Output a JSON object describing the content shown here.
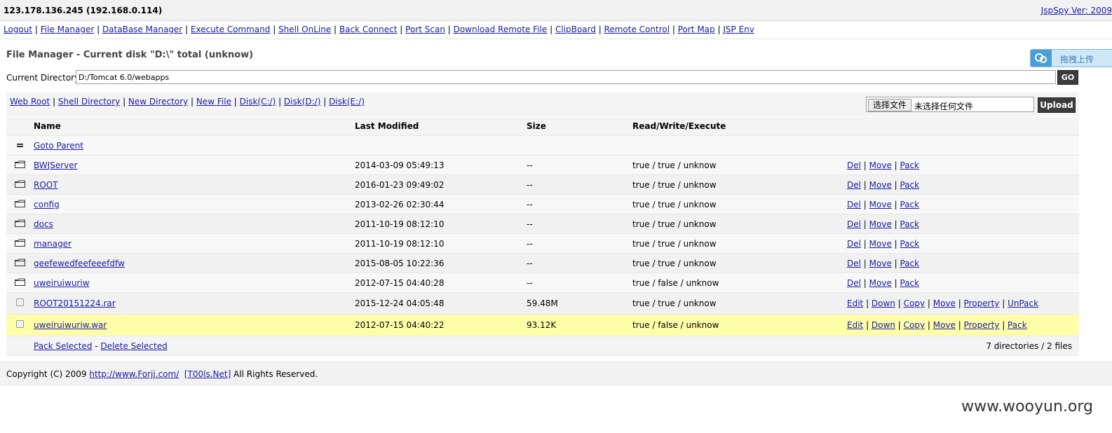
{
  "header": {
    "host": "123.178.136.245 (192.168.0.114)",
    "version": "JspSpy Ver: 2009"
  },
  "nav": [
    "Logout",
    "File Manager",
    "DataBase Manager",
    "Execute Command",
    "Shell OnLine",
    "Back Connect",
    "Port Scan",
    "Download Remote File",
    "ClipBoard",
    "Remote Control",
    "Port Map",
    "JSP Env"
  ],
  "title": "File Manager - Current disk \"D:\\\" total (unknow)",
  "upload_drag": "拖拽上传",
  "current_dir": {
    "label": "Current Directory",
    "value": "D:/Tomcat 6.0/webapps",
    "go": "GO"
  },
  "quick_links": [
    "Web Root",
    "Shell Directory",
    "New Directory",
    "New File",
    "Disk(C:/)",
    "Disk(D:/)",
    "Disk(E:/)"
  ],
  "file_upload": {
    "choose": "选择文件",
    "none": "未选择任何文件",
    "upload": "Upload"
  },
  "columns": {
    "name": "Name",
    "modified": "Last Modified",
    "size": "Size",
    "rwx": "Read/Write/Execute"
  },
  "parent": {
    "icon": "=",
    "label": "Goto Parent"
  },
  "dirs": [
    {
      "name": "BWJServer",
      "modified": "2014-03-09 05:49:13",
      "size": "--",
      "rwx": "true / true / unknow"
    },
    {
      "name": "ROOT",
      "modified": "2016-01-23 09:49:02",
      "size": "--",
      "rwx": "true / true / unknow"
    },
    {
      "name": "config",
      "modified": "2013-02-26 02:30:44",
      "size": "--",
      "rwx": "true / true / unknow"
    },
    {
      "name": "docs",
      "modified": "2011-10-19 08:12:10",
      "size": "--",
      "rwx": "true / true / unknow"
    },
    {
      "name": "manager",
      "modified": "2011-10-19 08:12:10",
      "size": "--",
      "rwx": "true / true / unknow"
    },
    {
      "name": "geefewedfeefeeefdfw",
      "modified": "2015-08-05 10:22:36",
      "size": "--",
      "rwx": "true / true / unknow"
    },
    {
      "name": "uweiruiwuriw",
      "modified": "2012-07-15 04:40:28",
      "size": "--",
      "rwx": "true / false / unknow"
    }
  ],
  "dir_actions": [
    "Del",
    "Move",
    "Pack"
  ],
  "files": [
    {
      "name": "ROOT20151224.rar",
      "modified": "2015-12-24 04:05:48",
      "size": "59.48M",
      "rwx": "true / true / unknow",
      "actions": [
        "Edit",
        "Down",
        "Copy",
        "Move",
        "Property",
        "UnPack"
      ]
    },
    {
      "name": "uweiruiwuriw.war",
      "modified": "2012-07-15 04:40:22",
      "size": "93.12K",
      "rwx": "true / false / unknow",
      "actions": [
        "Edit",
        "Down",
        "Copy",
        "Move",
        "Property",
        "Pack"
      ]
    }
  ],
  "highlight_color": "#ffffaa",
  "footer_actions": {
    "pack": "Pack Selected",
    "sep": "-",
    "delete": "Delete Selected",
    "summary": "7 directories / 2 files"
  },
  "copyright": {
    "prefix": "Copyright (C) 2009",
    "link": "http://www.Forjj.com/",
    "team": "[T00ls.Net]",
    "suffix": "All Rights Reserved."
  },
  "watermark": "www.wooyun.org"
}
